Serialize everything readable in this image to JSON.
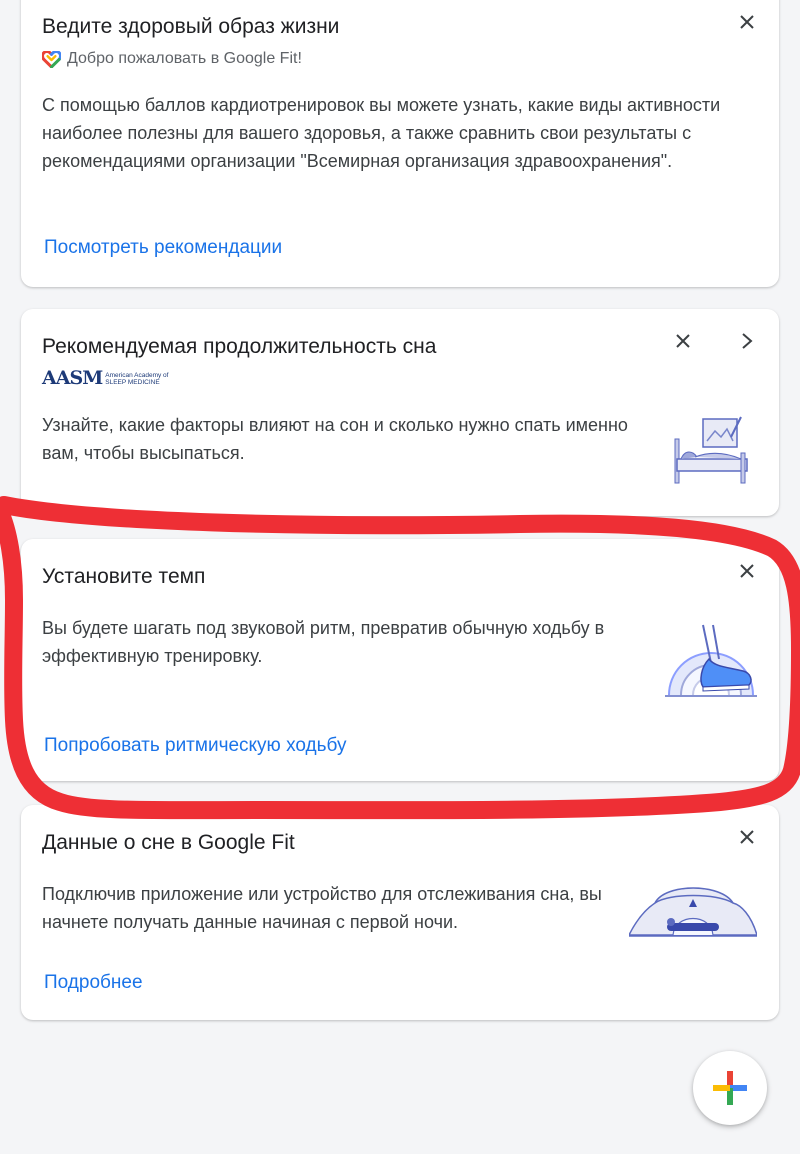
{
  "cards": [
    {
      "title": "Ведите здоровый образ жизни",
      "subtitle": "Добро пожаловать в Google Fit!",
      "body": "С помощью баллов кардиотренировок вы можете узнать, какие виды активности наиболее полезны для вашего здоровья, а также сравнить свои результаты с рекомендациями организации \"Всемирная организация здравоохранения\".",
      "link": "Посмотреть рекомендации"
    },
    {
      "title": "Рекомендуемая продолжительность сна",
      "logo_text": "AASM",
      "logo_sub": "American Academy of SLEEP MEDICINE",
      "body": "Узнайте, какие факторы влияют на сон и сколько нужно спать именно вам, чтобы высыпаться."
    },
    {
      "title": "Установите темп",
      "body": "Вы будете шагать под звуковой ритм, превратив обычную ходьбу в эффективную тренировку.",
      "link": "Попробовать ритмическую ходьбу"
    },
    {
      "title": "Данные о сне в Google Fit",
      "body": "Подключив приложение или устройство для отслеживания сна, вы начнете получать данные начиная с первой ночи.",
      "link": "Подробнее"
    }
  ],
  "colors": {
    "link": "#1a73e8",
    "annotation": "#ee2f35",
    "fab_blue": "#4285f4",
    "fab_red": "#ea4335",
    "fab_yellow": "#fbbc04",
    "fab_green": "#34a853"
  },
  "icons": [
    "google-fit-heart-icon",
    "close-icon",
    "chevron-right-icon",
    "add-icon"
  ]
}
